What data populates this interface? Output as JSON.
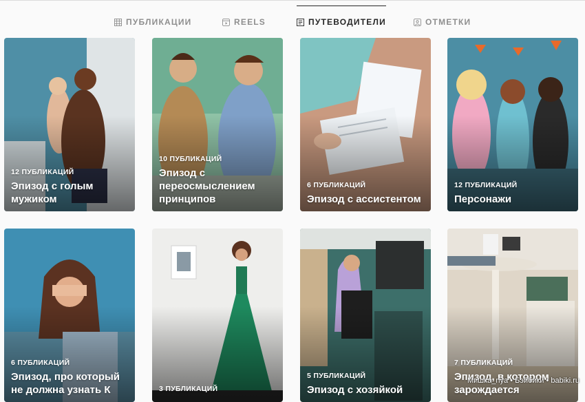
{
  "tabs": [
    {
      "label": "ПУБЛИКАЦИИ",
      "icon": "grid-icon",
      "active": false
    },
    {
      "label": "REELS",
      "icon": "reels-icon",
      "active": false
    },
    {
      "label": "ПУТЕВОДИТЕЛИ",
      "icon": "guide-icon",
      "active": true
    },
    {
      "label": "ОТМЕТКИ",
      "icon": "tagged-icon",
      "active": false
    }
  ],
  "guides": [
    {
      "count": "12 ПУБЛИКАЦИЙ",
      "title": "Эпизод с голым мужиком"
    },
    {
      "count": "10 ПУБЛИКАЦИЙ",
      "title": "Эпизод с переосмыслением принципов"
    },
    {
      "count": "6 ПУБЛИКАЦИЙ",
      "title": "Эпизод с ассистентом"
    },
    {
      "count": "12 ПУБЛИКАЦИЙ",
      "title": "Персонажи"
    },
    {
      "count": "6 ПУБЛИКАЦИЙ",
      "title": "Эпизод, про который не должна узнать К"
    },
    {
      "count": "3 ПУБЛИКАЦИЙ",
      "title": ""
    },
    {
      "count": "5 ПУБЛИКАЦИЙ",
      "title": "Эпизод с хозяйкой"
    },
    {
      "count": "7 ПУБЛИКАЦИЙ",
      "title": "Эпизод, в котором зарождается"
    }
  ],
  "watermark": "Мишка_nya • Бэйбики • babiki.ru",
  "colors": {
    "active_tab": "#262626",
    "inactive_tab": "#8e8e8e",
    "background": "#fafafa"
  }
}
